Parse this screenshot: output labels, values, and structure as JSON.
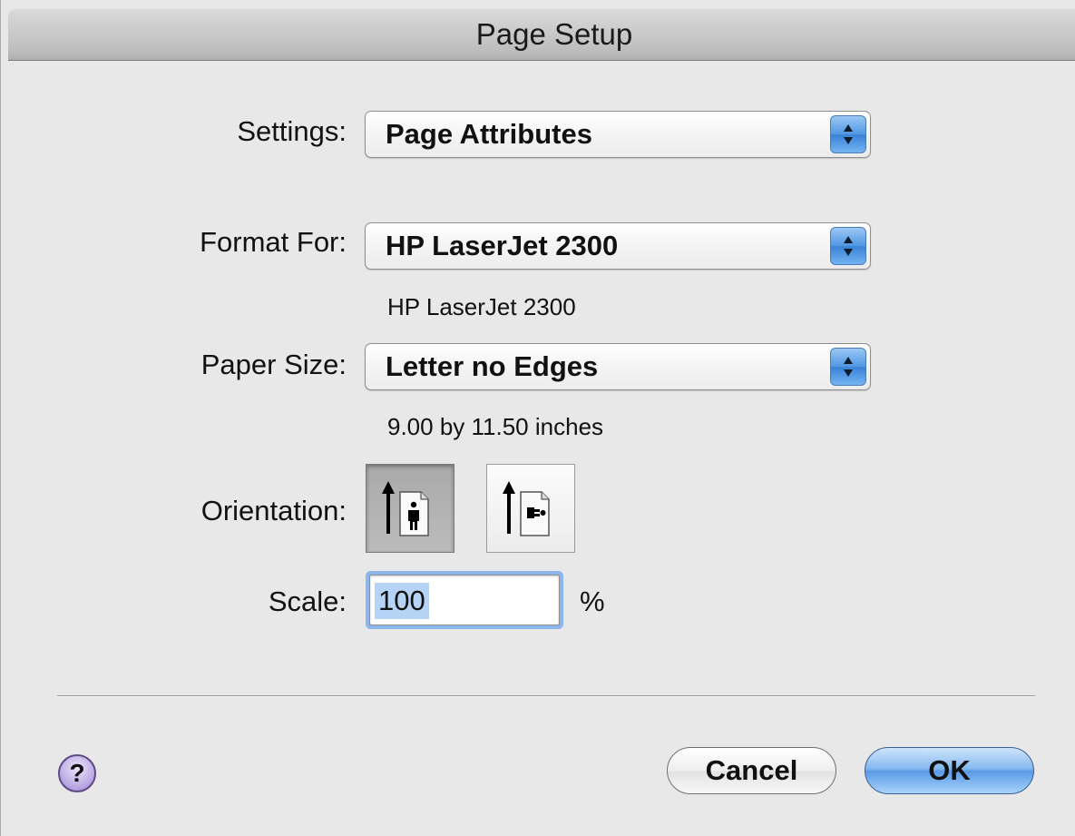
{
  "window": {
    "title": "Page Setup"
  },
  "settings": {
    "label": "Settings:",
    "value": "Page Attributes"
  },
  "format_for": {
    "label": "Format For:",
    "value": "HP LaserJet 2300",
    "detail": "HP LaserJet 2300"
  },
  "paper_size": {
    "label": "Paper Size:",
    "value": "Letter no Edges",
    "detail": "9.00 by 11.50 inches"
  },
  "orientation": {
    "label": "Orientation:",
    "options": [
      {
        "name": "portrait",
        "selected": true
      },
      {
        "name": "landscape",
        "selected": false
      }
    ]
  },
  "scale": {
    "label": "Scale:",
    "value": "100",
    "unit": "%"
  },
  "buttons": {
    "help": "?",
    "cancel": "Cancel",
    "ok": "OK"
  },
  "colors": {
    "default_button": "#5b9ae4",
    "focus_ring": "#8db7ec",
    "help_button": "#b7a4e0"
  }
}
